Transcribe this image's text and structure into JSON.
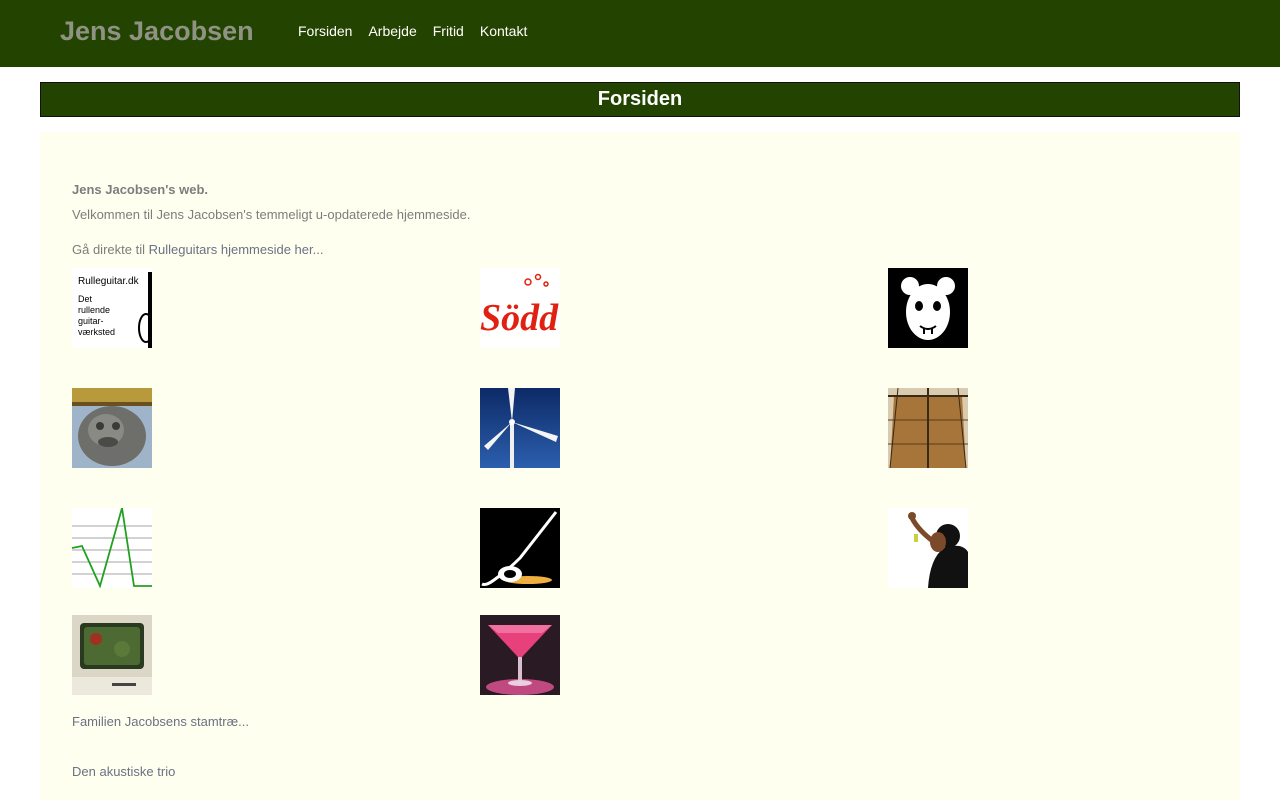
{
  "header": {
    "site_title": "Jens Jacobsen",
    "nav": [
      "Forsiden",
      "Arbejde",
      "Fritid",
      "Kontakt"
    ]
  },
  "page": {
    "heading": "Forsiden"
  },
  "main": {
    "intro_title": "Jens Jacobsen's web.",
    "intro_text": "Velkommen til Jens Jacobsen's temmeligt u-opdaterede hjemmeside.",
    "direct_prefix": "Gå direkte til ",
    "direct_link": "Rulleguitars hjemmeside her...",
    "rulleguitar_logo": {
      "line1": "Rulleguitar.dk",
      "line2": "Det",
      "line3": "rullende",
      "line4": "guitar-",
      "line5": "værksted"
    },
    "sodo_logo_text": "Södd",
    "thumbnails": [
      "rulleguitar-logo",
      "sodo-logo",
      "mouse-mask-icon",
      "stone-lion-photo",
      "wind-turbine-photo",
      "sailing-ship-photo",
      "green-waveform-graphic",
      "black-guitar-graphic",
      "singer-photo",
      "old-computer-photo",
      "cocktail-photo"
    ],
    "family_tree_link": "Familien Jacobsens stamtræ...",
    "trio_link": "Den akustiske trio"
  },
  "colors": {
    "header_bg": "#224400",
    "content_bg": "#fffff0",
    "text_gray": "#7d7d7d",
    "link_gray": "#6a7283"
  }
}
